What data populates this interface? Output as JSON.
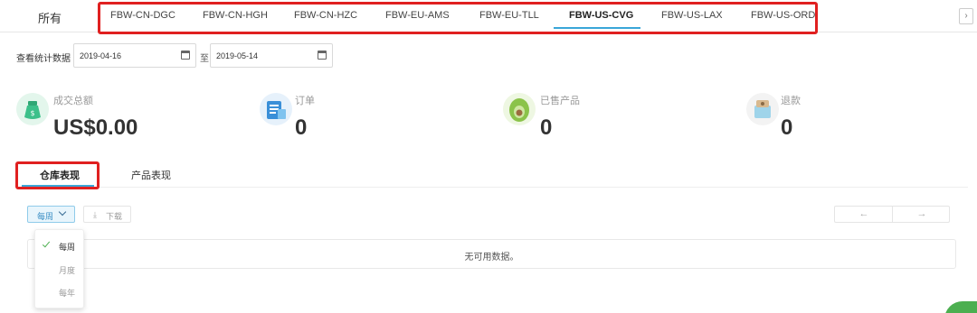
{
  "tabs": {
    "all_label": "所有",
    "items": [
      {
        "label": "FBW-CN-DGC"
      },
      {
        "label": "FBW-CN-HGH"
      },
      {
        "label": "FBW-CN-HZC"
      },
      {
        "label": "FBW-EU-AMS"
      },
      {
        "label": "FBW-EU-TLL"
      },
      {
        "label": "FBW-US-CVG"
      },
      {
        "label": "FBW-US-LAX"
      },
      {
        "label": "FBW-US-ORD"
      }
    ],
    "active": "FBW-US-CVG",
    "scroll_right": "›"
  },
  "filter": {
    "label": "查看统计数据",
    "start_date": "2019-04-16",
    "separator": "至",
    "end_date": "2019-05-14"
  },
  "stats": [
    {
      "label": "成交总额",
      "value": "US$0.00",
      "icon": "money-bag-icon",
      "color": "#3cc08a"
    },
    {
      "label": "订单",
      "value": "0",
      "icon": "orders-icon",
      "color": "#3a8fd8"
    },
    {
      "label": "已售产品",
      "value": "0",
      "icon": "avocado-icon",
      "color": "#8bc34a"
    },
    {
      "label": "退款",
      "value": "0",
      "icon": "refund-box-icon",
      "color": "#9fd4ea"
    }
  ],
  "subtabs": [
    {
      "label": "仓库表现"
    },
    {
      "label": "产品表现"
    }
  ],
  "toolbar": {
    "period_selected": "每周",
    "download_label": "下载",
    "prev": "←",
    "next": "→"
  },
  "dropdown": {
    "options": [
      {
        "label": "每周",
        "selected": true
      },
      {
        "label": "月度",
        "selected": false
      },
      {
        "label": "每年",
        "selected": false
      }
    ]
  },
  "empty_message": "无可用数据。",
  "colors": {
    "accent": "#3aa6d8",
    "highlight_box": "#e02020",
    "check": "#4caf50"
  }
}
